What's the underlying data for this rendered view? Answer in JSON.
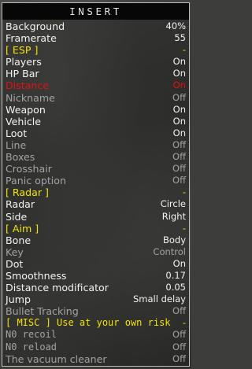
{
  "menu": {
    "title": "INSERT",
    "colors": {
      "active": "#f2f2f2",
      "inactive": "#a3a3a3",
      "section": "#f2e400",
      "selected": "#e21111",
      "title_bar": "#070707",
      "border": "#bdbdbd"
    },
    "rows": [
      {
        "label": "Background",
        "value": "40%",
        "color": "white",
        "font": "sans",
        "interactable": true
      },
      {
        "label": "Framerate",
        "value": "55",
        "color": "white",
        "font": "sans",
        "interactable": true
      },
      {
        "label": "[ ESP ]",
        "value": "-",
        "color": "yellow",
        "font": "sans",
        "interactable": true
      },
      {
        "label": "Players",
        "value": "On",
        "color": "white",
        "font": "sans",
        "interactable": true
      },
      {
        "label": "HP Bar",
        "value": "On",
        "color": "white",
        "font": "sans",
        "interactable": true
      },
      {
        "label": "Distance",
        "value": "On",
        "color": "red",
        "font": "sans",
        "interactable": true
      },
      {
        "label": "Nickname",
        "value": "Off",
        "color": "gray",
        "font": "sans",
        "interactable": true
      },
      {
        "label": "Weapon",
        "value": "On",
        "color": "white",
        "font": "sans",
        "interactable": true
      },
      {
        "label": "Vehicle",
        "value": "On",
        "color": "white",
        "font": "sans",
        "interactable": true
      },
      {
        "label": "Loot",
        "value": "On",
        "color": "white",
        "font": "sans",
        "interactable": true
      },
      {
        "label": "Line",
        "value": "Off",
        "color": "gray",
        "font": "sans",
        "interactable": true
      },
      {
        "label": "Boxes",
        "value": "Off",
        "color": "gray",
        "font": "sans",
        "interactable": true
      },
      {
        "label": "Crosshair",
        "value": "Off",
        "color": "gray",
        "font": "sans",
        "interactable": true
      },
      {
        "label": "Panic option",
        "value": "Off",
        "color": "gray",
        "font": "sans",
        "interactable": true
      },
      {
        "label": "[ Radar ]",
        "value": "-",
        "color": "yellow",
        "font": "sans",
        "interactable": true
      },
      {
        "label": "Radar",
        "value": "Circle",
        "color": "white",
        "font": "sans",
        "interactable": true
      },
      {
        "label": "Side",
        "value": "Right",
        "color": "white",
        "font": "sans",
        "interactable": true
      },
      {
        "label": "[ Aim ]",
        "value": "-",
        "color": "yellow",
        "font": "sans",
        "interactable": true
      },
      {
        "label": "Bone",
        "value": "Body",
        "color": "white",
        "font": "sans",
        "interactable": true
      },
      {
        "label": "Key",
        "value": "Control",
        "color": "gray",
        "font": "sans",
        "interactable": true
      },
      {
        "label": "Dot",
        "value": "On",
        "color": "white",
        "font": "sans",
        "interactable": true
      },
      {
        "label": "Smoothness",
        "value": "0.17",
        "color": "white",
        "font": "sans",
        "interactable": true
      },
      {
        "label": "Distance modificator",
        "value": "0.05",
        "color": "white",
        "font": "sans",
        "interactable": true
      },
      {
        "label": "Jump",
        "value": "Small delay",
        "color": "white",
        "font": "sans",
        "interactable": true
      },
      {
        "label": "Bullet Tracking",
        "value": "Off",
        "color": "gray",
        "font": "sans",
        "interactable": true
      },
      {
        "label": "[ MISC ] Use at your own risk",
        "value": "-",
        "color": "yellow",
        "font": "mono",
        "interactable": true
      },
      {
        "label": "N0 recoil",
        "value": "Off",
        "color": "gray",
        "font": "mono",
        "interactable": true
      },
      {
        "label": "N0 reload",
        "value": "Off",
        "color": "gray",
        "font": "mono",
        "interactable": true
      },
      {
        "label": "The vacuum cleaner",
        "value": "Off",
        "color": "gray",
        "font": "sans",
        "interactable": true
      }
    ]
  }
}
